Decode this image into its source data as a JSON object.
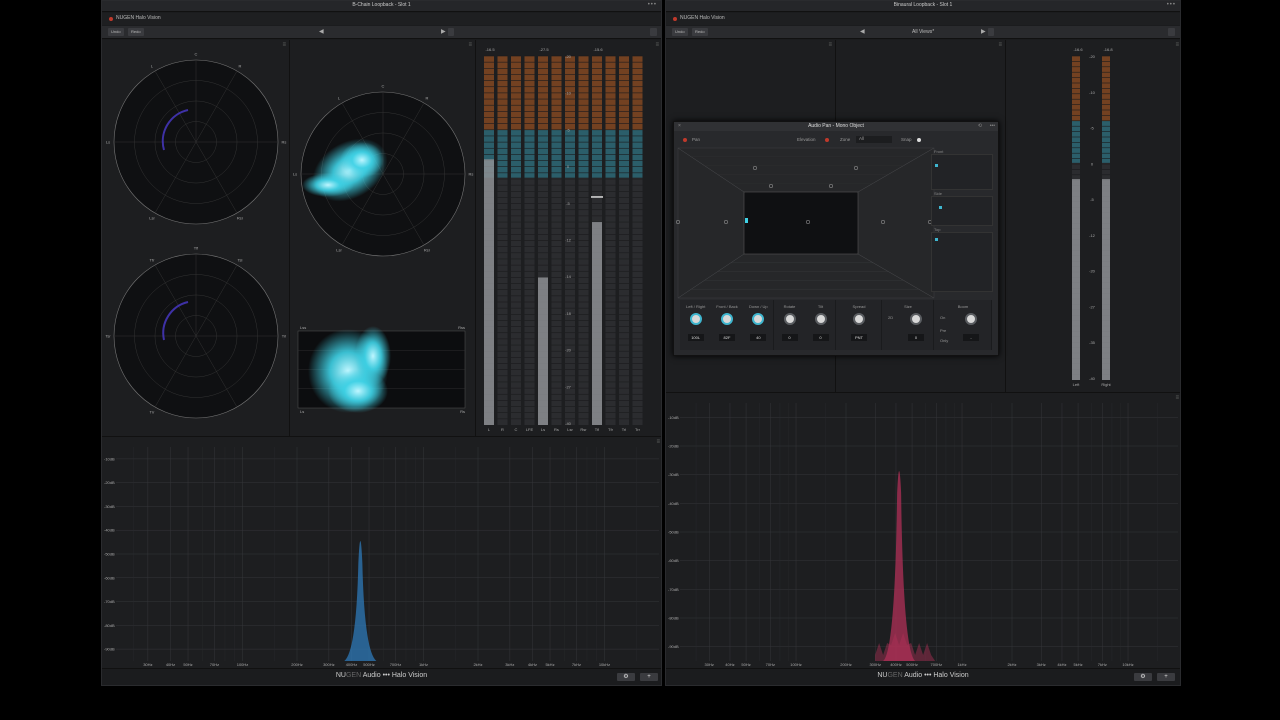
{
  "left_window": {
    "title": "B-Chain Loopback - Slot 1",
    "plugin": "NUGEN Halo Vision",
    "undo": "Undo",
    "redo": "Redo",
    "radar1_labels": [
      "C",
      "L",
      "R",
      "Ls",
      "Rs",
      "Lsr",
      "Rsr"
    ],
    "radar2_labels": [
      "Tfl",
      "Tfr",
      "Tsl",
      "Tsr",
      "Trl",
      "Trr"
    ],
    "radar3_labels": [
      "C",
      "L",
      "R",
      "Ls",
      "Rs",
      "Lsr",
      "Rsr"
    ],
    "heat_corner_labels": [
      "Lss",
      "Rss",
      "Ls",
      "Rs"
    ],
    "meter_top_values": [
      "-16.5",
      "-27.5",
      "-15.6"
    ],
    "meter_scale": [
      "-20",
      "-10",
      "-5",
      "0",
      "-5",
      "-12",
      "-14",
      "-18",
      "-20",
      "-27",
      "-40"
    ],
    "meter_channels": [
      "L",
      "R",
      "C",
      "LFE",
      "Ls",
      "Rs",
      "Lsr",
      "Rsr",
      "Tfl",
      "Tfr",
      "Trl",
      "Trr"
    ],
    "meter_levels": [
      0.72,
      0,
      0,
      0,
      0.4,
      0,
      0,
      0,
      0.55,
      0,
      0,
      0
    ],
    "meter_peaks": [
      0,
      0,
      0,
      0,
      0,
      0,
      0,
      0,
      0.62,
      0,
      0,
      0
    ],
    "spec_db": [
      "-10dB",
      "-20dB",
      "-30dB",
      "-40dB",
      "-50dB",
      "-60dB",
      "-70dB",
      "-80dB",
      "-90dB"
    ],
    "spec_freq": [
      "30Hz",
      "40Hz",
      "50Hz",
      "70Hz",
      "100Hz",
      "200Hz",
      "300Hz",
      "400Hz",
      "500Hz",
      "700Hz",
      "1kHz",
      "2kHz",
      "3kHz",
      "4kHz",
      "5kHz",
      "7kHz",
      "10kHz"
    ],
    "footer_brand_a": "NU",
    "footer_brand_b": "GEN",
    "footer_brand_c": " Audio ••• Halo Vision"
  },
  "right_window": {
    "title": "Binaural Loopback - Slot 1",
    "plugin": "NUGEN Halo Vision",
    "undo": "Undo",
    "redo": "Redo",
    "view": "All Views*",
    "meter_top_values": [
      "-16.6",
      "-16.8"
    ],
    "meter_channels": [
      "Left",
      "Right"
    ],
    "meter_scale": [
      "-20",
      "-10",
      "-5",
      "0",
      "-5",
      "-12",
      "-20",
      "-27",
      "-35",
      "-40"
    ],
    "meter_levels": [
      0.62,
      0.62
    ],
    "spec_db": [
      "-10dB",
      "-20dB",
      "-30dB",
      "-40dB",
      "-50dB",
      "-60dB",
      "-70dB",
      "-80dB",
      "-90dB"
    ],
    "spec_freq": [
      "30Hz",
      "40Hz",
      "50Hz",
      "70Hz",
      "100Hz",
      "200Hz",
      "300Hz",
      "400Hz",
      "500Hz",
      "700Hz",
      "1kHz",
      "2kHz",
      "3kHz",
      "4kHz",
      "5kHz",
      "7kHz",
      "10kHz"
    ],
    "footer_brand_a": "NU",
    "footer_brand_b": "GEN",
    "footer_brand_c": " Audio ••• Halo Vision"
  },
  "audio_pan": {
    "title": "Audio Pan - Mono Object",
    "pan": "Pan",
    "elevation": "Elevation",
    "zone": "Zone",
    "zone_value": "All",
    "snap": "Snap",
    "mini_front": "Front",
    "mini_side": "Side",
    "mini_top": "Top",
    "groups": [
      {
        "label": "Left / Right",
        "value": "100L"
      },
      {
        "label": "Front / Back",
        "value": "82F"
      },
      {
        "label": "Down / Up",
        "value": "40"
      },
      {
        "label": "Rotate",
        "value": "0"
      },
      {
        "label": "Tilt",
        "value": "0"
      },
      {
        "label": "Spread",
        "value": "PNT"
      },
      {
        "label": "Size",
        "value": "0"
      },
      {
        "label": "Boom",
        "value": "-"
      }
    ],
    "size_mode": "2D",
    "boom_on": "On",
    "boom_pre": "Pre",
    "boom_only": "Only"
  },
  "colors": {
    "cyan": "#3fd2e6",
    "blue_spec": "#2e79b8",
    "red_spec": "#b03057",
    "meter_orange": "#8a4a22",
    "meter_teal": "#2e6a78",
    "meter_gray": "#5a5c5f"
  }
}
